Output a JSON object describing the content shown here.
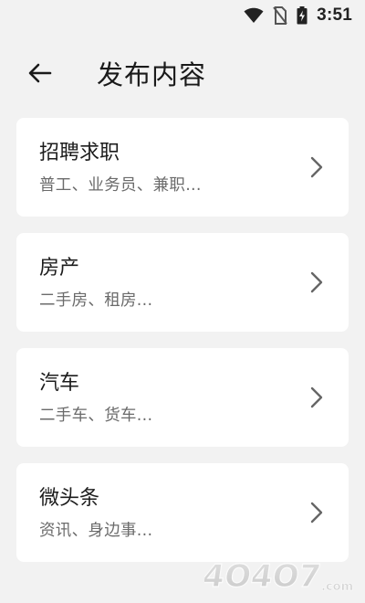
{
  "status_bar": {
    "time": "3:51",
    "icons": [
      "wifi-icon",
      "no-sim-icon",
      "battery-charging-icon"
    ]
  },
  "header": {
    "back_icon": "arrow-left-icon",
    "title": "发布内容"
  },
  "cards": [
    {
      "title": "招聘求职",
      "subtitle": "普工、业务员、兼职...",
      "icon": "chevron-right-icon"
    },
    {
      "title": "房产",
      "subtitle": "二手房、租房...",
      "icon": "chevron-right-icon"
    },
    {
      "title": "汽车",
      "subtitle": "二手车、货车...",
      "icon": "chevron-right-icon"
    },
    {
      "title": "微头条",
      "subtitle": "资讯、身边事...",
      "icon": "chevron-right-icon"
    }
  ],
  "watermark": {
    "text": "4O4O7.com"
  },
  "colors": {
    "background": "#f2f2f2",
    "card": "#ffffff",
    "title_text": "#1c1c1c",
    "subtitle_text": "#6b6b6b"
  }
}
